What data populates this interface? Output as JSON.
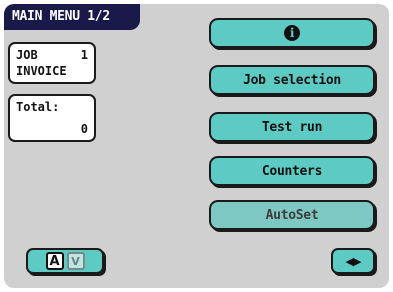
{
  "header": {
    "title": "MAIN MENU 1/2"
  },
  "job_panel": {
    "label_line1": "JOB",
    "label_line2": "INVOICE",
    "job_number": "1"
  },
  "total_panel": {
    "label": "Total:",
    "value": "0"
  },
  "menu": {
    "info_icon_glyph": "i",
    "job_selection_label": "Job selection",
    "test_run_label": "Test run",
    "counters_label": "Counters",
    "autoset_label": "AutoSet"
  },
  "footer": {
    "lang_key_a": "A",
    "lang_key_v": "V",
    "nav_arrows": "◀▶"
  },
  "colors": {
    "accent": "#5ecac4",
    "panel_background": "#cfd0cf",
    "header_background": "#1a1a4a"
  },
  "icons": [
    "info-icon",
    "keyboard-a-icon",
    "keyboard-v-icon",
    "left-right-arrows-icon"
  ]
}
